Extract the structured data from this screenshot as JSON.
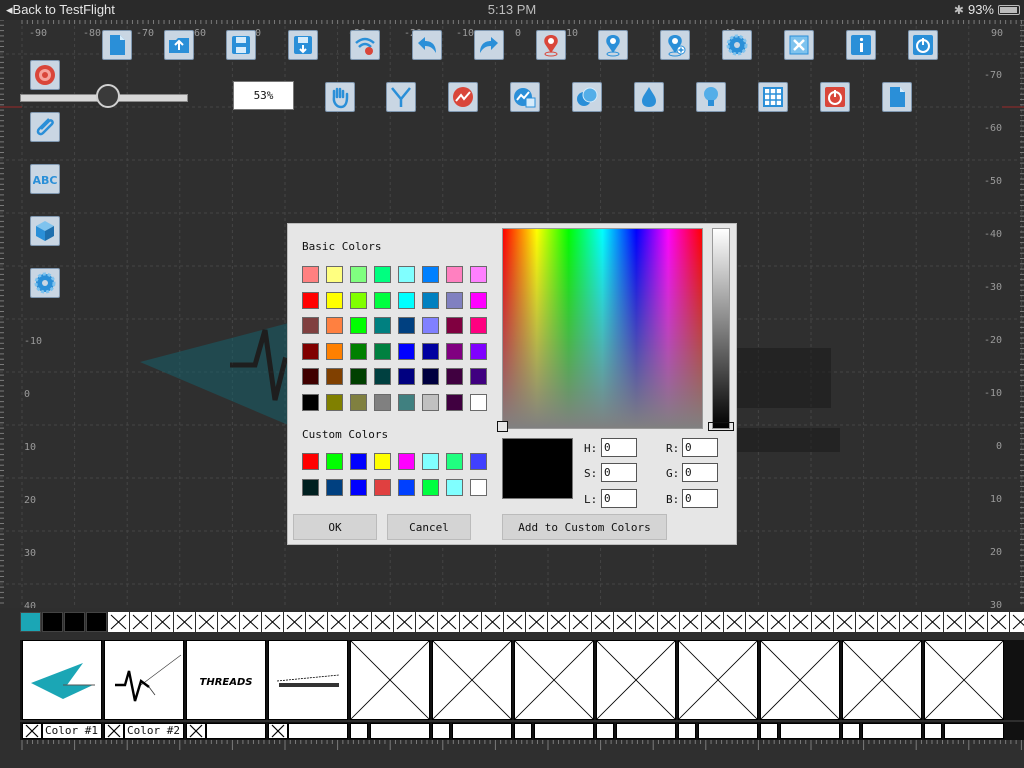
{
  "status_bar": {
    "back_label": "Back to TestFlight",
    "time": "5:13 PM",
    "battery": "93%",
    "battery_level": 0.93
  },
  "rulers": {
    "top_labels": [
      "-90",
      "-80",
      "-70",
      "-60",
      "0",
      "-30",
      "-20",
      "-10",
      "0",
      "10",
      "40",
      "90"
    ],
    "right_labels": [
      "-70",
      "-60",
      "-50",
      "-40",
      "-30",
      "-20",
      "-10",
      "0",
      "10",
      "20",
      "30",
      "40"
    ],
    "left_labels": [
      "-10",
      "0",
      "10",
      "20",
      "30",
      "40"
    ]
  },
  "toolbar": {
    "zoom_value": "53%",
    "slider_value": 0.53,
    "top_row": [
      {
        "name": "new-document-icon"
      },
      {
        "name": "open-folder-icon"
      },
      {
        "name": "save-icon"
      },
      {
        "name": "save-download-icon"
      },
      {
        "name": "wireless-icon"
      },
      {
        "name": "undo-icon"
      },
      {
        "name": "redo-icon"
      },
      {
        "name": "location-pin-red-icon"
      },
      {
        "name": "location-pin-icon"
      },
      {
        "name": "location-pin-add-icon"
      },
      {
        "name": "settings-gear-icon"
      },
      {
        "name": "close-x-icon"
      },
      {
        "name": "info-icon"
      },
      {
        "name": "power-icon"
      }
    ],
    "second_row": [
      {
        "name": "hand-pan-icon"
      },
      {
        "name": "node-edit-icon"
      },
      {
        "name": "trend-line-icon"
      },
      {
        "name": "chart-doc-icon"
      },
      {
        "name": "overlap-circles-icon"
      },
      {
        "name": "water-drop-icon"
      },
      {
        "name": "lightbulb-icon"
      },
      {
        "name": "grid-table-icon"
      },
      {
        "name": "power-red-icon"
      },
      {
        "name": "blank-page-icon"
      }
    ],
    "side_column": [
      {
        "name": "target-icon"
      },
      {
        "name": "paperclip-icon"
      },
      {
        "name": "abc-text-icon"
      },
      {
        "name": "cube-3d-icon"
      },
      {
        "name": "settings-gear-side-icon"
      }
    ]
  },
  "color_dialog": {
    "basic_colors_label": "Basic Colors",
    "custom_colors_label": "Custom Colors",
    "basic_colors": [
      [
        "#ff8080",
        "#ffff80",
        "#80ff80",
        "#00ff80",
        "#80ffff",
        "#0080ff",
        "#ff80c0",
        "#ff80ff"
      ],
      [
        "#ff0000",
        "#ffff00",
        "#80ff00",
        "#00ff40",
        "#00ffff",
        "#0080c0",
        "#8080c0",
        "#ff00ff"
      ],
      [
        "#804040",
        "#ff8040",
        "#00ff00",
        "#008080",
        "#004080",
        "#8080ff",
        "#800040",
        "#ff0080"
      ],
      [
        "#800000",
        "#ff8000",
        "#008000",
        "#008040",
        "#0000ff",
        "#0000a0",
        "#800080",
        "#8000ff"
      ],
      [
        "#400000",
        "#804000",
        "#004000",
        "#004040",
        "#000080",
        "#000040",
        "#400040",
        "#400080"
      ],
      [
        "#000000",
        "#808000",
        "#808040",
        "#808080",
        "#408080",
        "#c0c0c0",
        "#400040",
        "#ffffff"
      ]
    ],
    "custom_colors": [
      [
        "#ff0000",
        "#00ff00",
        "#0000ff",
        "#ffff00",
        "#ff00ff",
        "#80ffff",
        "#20ff80",
        "#4040ff"
      ],
      [
        "#002020",
        "#004080",
        "#0000ff",
        "#e04040",
        "#0040ff",
        "#00ff40",
        "#80ffff",
        "#ffffff"
      ]
    ],
    "current_color": "#000000",
    "fields": {
      "h_label": "H:",
      "h_value": "0",
      "s_label": "S:",
      "s_value": "0",
      "l_label": "L:",
      "l_value": "0",
      "r_label": "R:",
      "r_value": "0",
      "g_label": "G:",
      "g_value": "0",
      "b_label": "B:",
      "b_value": "0"
    },
    "ok_label": "OK",
    "cancel_label": "Cancel",
    "add_custom_label": "Add to Custom Colors"
  },
  "color_strip": {
    "first_color": "#1ba6b5",
    "filled_color": "#000000",
    "filled_count": 3
  },
  "thumbnails": {
    "designs": [
      {
        "name": "thumb-teal-arrow",
        "color": "#1ba6b5"
      },
      {
        "name": "thumb-black-zigzag",
        "color": "#000000"
      },
      {
        "name": "thumb-threads-logo",
        "text": "THREADS"
      },
      {
        "name": "thumb-software-text",
        "color": "#000000"
      }
    ],
    "empty_count": 8
  },
  "label_row": {
    "color1_label": "Color #1",
    "color2_label": "Color #2"
  }
}
